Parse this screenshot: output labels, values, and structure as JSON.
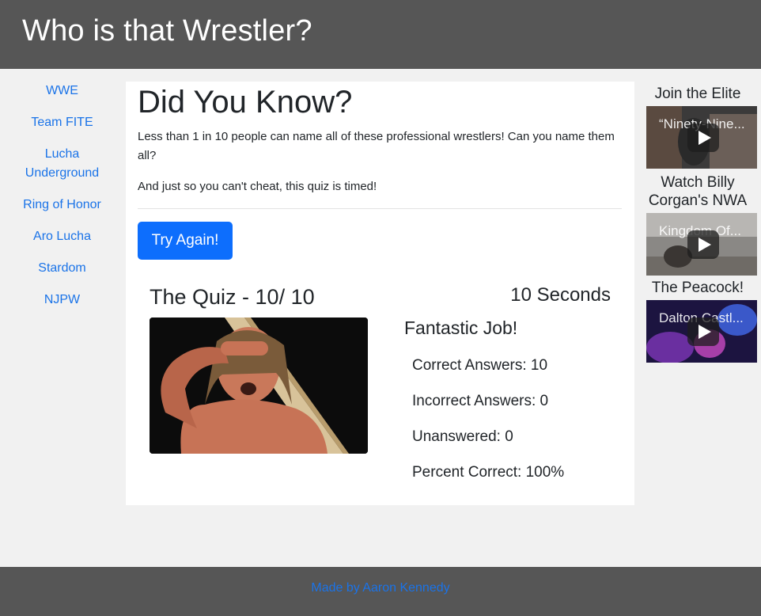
{
  "header": {
    "title": "Who is that Wrestler?"
  },
  "nav": {
    "items": [
      {
        "label": "WWE"
      },
      {
        "label": "Team FITE"
      },
      {
        "label": "Lucha Underground"
      },
      {
        "label": "Ring of Honor"
      },
      {
        "label": "Aro Lucha"
      },
      {
        "label": "Stardom"
      },
      {
        "label": "NJPW"
      }
    ]
  },
  "main": {
    "headline": "Did You Know?",
    "lead": "Less than 1 in 10 people can name all of these professional wrestlers! Can you name them all?",
    "lead2": "And just so you can't cheat, this quiz is timed!",
    "button_label": "Try Again!",
    "quiz_title": "The Quiz - 10/ 10",
    "timer": "10 Seconds",
    "results": {
      "heading": "Fantastic Job!",
      "correct": "Correct Answers: 10",
      "incorrect": "Incorrect Answers: 0",
      "unanswered": "Unanswered: 0",
      "percent": "Percent Correct: 100%"
    }
  },
  "sidebar": {
    "videos": [
      {
        "title": "Join the Elite",
        "caption": "“Ninety-Nine...",
        "icon": "play-icon"
      },
      {
        "title": "Watch Billy Corgan's NWA",
        "caption": "Kingdom Of...",
        "icon": "play-icon"
      },
      {
        "title": "The Peacock!",
        "caption": "Dalton Castl...",
        "icon": "play-icon"
      }
    ]
  },
  "footer": {
    "link": "Made by Aaron Kennedy"
  },
  "colors": {
    "header_bg": "#565656",
    "link": "#1a73e8",
    "button": "#0d6efd",
    "page_bg": "#f1f1f1"
  }
}
